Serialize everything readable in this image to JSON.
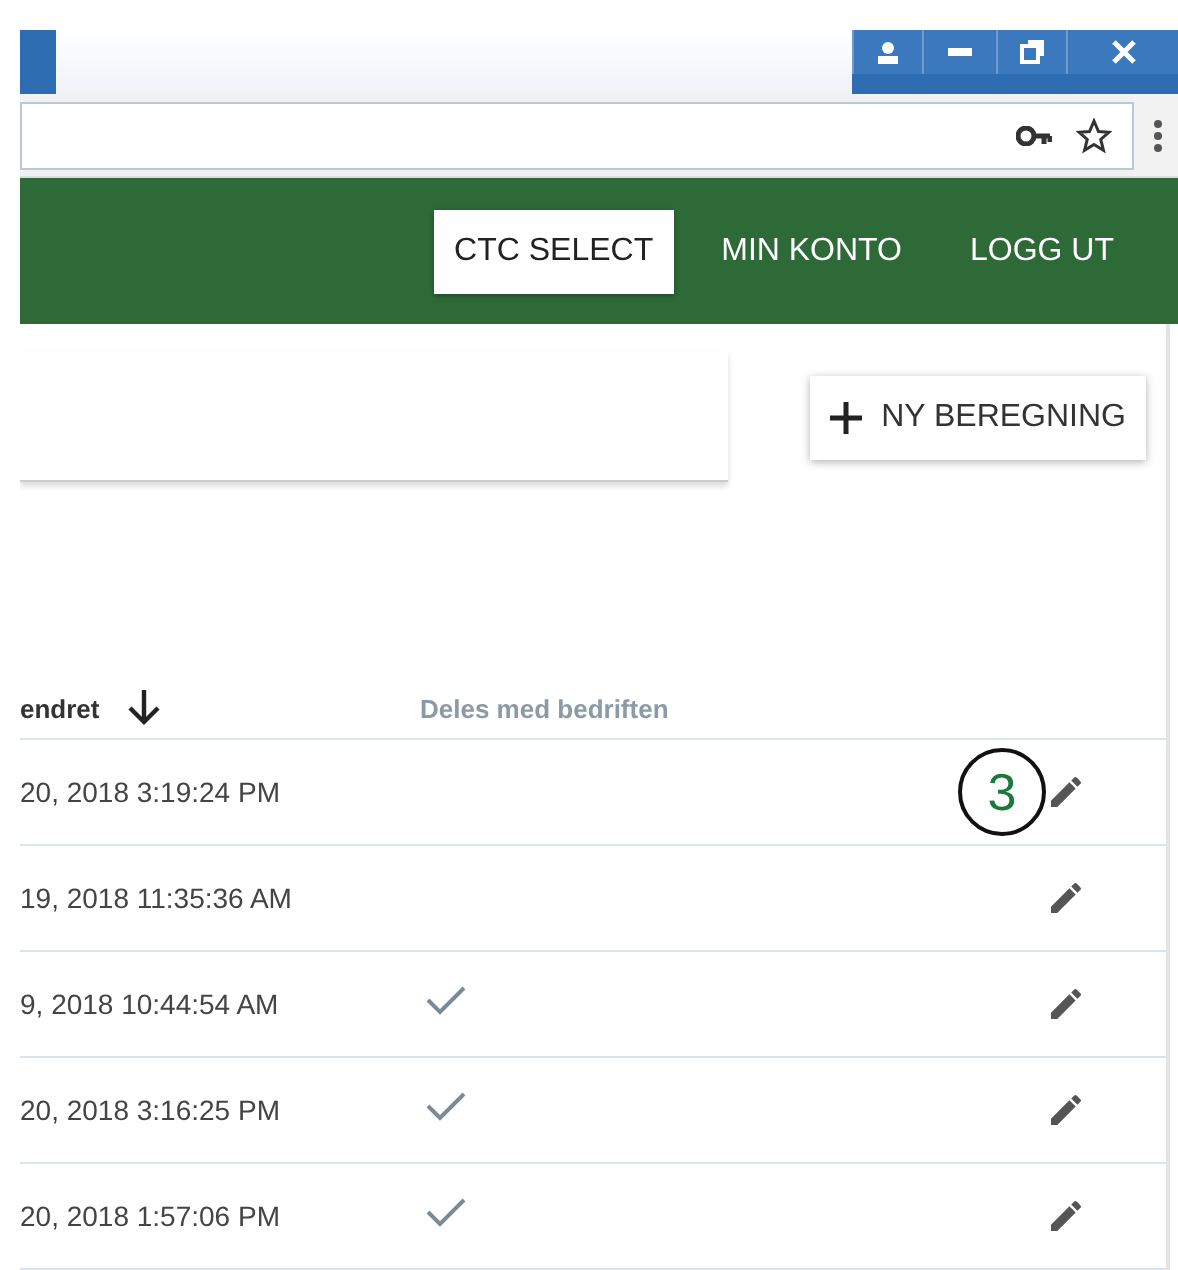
{
  "nav": {
    "items": [
      {
        "label": "CTC SELECT",
        "selected": true
      },
      {
        "label": "MIN KONTO",
        "selected": false
      },
      {
        "label": "LOGG UT",
        "selected": false
      }
    ]
  },
  "toolbar": {
    "button": "NY BEREGNING"
  },
  "table": {
    "columns": [
      {
        "label": "endret",
        "sorted": true
      },
      {
        "label": "Deles med bedriften",
        "sorted": false
      }
    ],
    "rows": [
      {
        "date": "20, 2018 3:19:24 PM",
        "shared": false
      },
      {
        "date": "19, 2018 11:35:36 AM",
        "shared": false
      },
      {
        "date": "9, 2018 10:44:54 AM",
        "shared": true
      },
      {
        "date": "20, 2018 3:16:25 PM",
        "shared": true
      },
      {
        "date": "20, 2018 1:57:06 PM",
        "shared": true
      }
    ]
  },
  "callout": {
    "label": "3"
  }
}
